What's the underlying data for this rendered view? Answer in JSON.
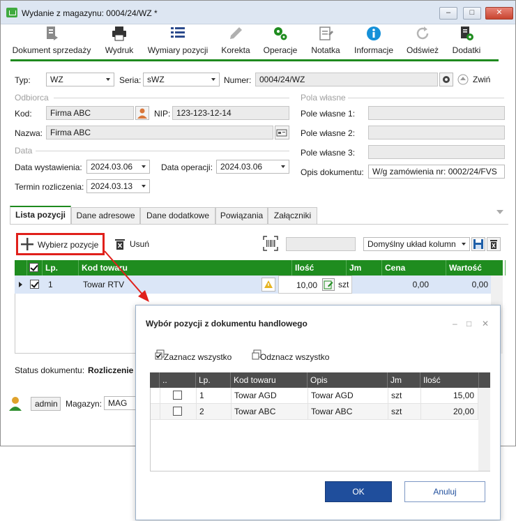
{
  "window": {
    "title": "Wydanie z magazynu: 0004/24/WZ *",
    "minimize": "–",
    "maximize": "□",
    "close": "✕"
  },
  "toolbar": {
    "doc_sales": "Dokument sprzedaży",
    "print": "Wydruk",
    "dimensions": "Wymiary pozycji",
    "correction": "Korekta",
    "operations": "Operacje",
    "note": "Notatka",
    "info": "Informacje",
    "refresh": "Odśwież",
    "addons": "Dodatki"
  },
  "header": {
    "type_label": "Typ:",
    "type_value": "WZ",
    "series_label": "Seria:",
    "series_value": "sWZ",
    "number_label": "Numer:",
    "number_value": "0004/24/WZ",
    "collapse": "Zwiń"
  },
  "recipient": {
    "group": "Odbiorca",
    "code_label": "Kod:",
    "code_value": "Firma ABC",
    "nip_label": "NIP:",
    "nip_value": "123-123-12-14",
    "name_label": "Nazwa:",
    "name_value": "Firma ABC"
  },
  "dates": {
    "group": "Data",
    "issue_label": "Data wystawienia:",
    "issue_value": "2024.03.06",
    "operation_label": "Data operacji:",
    "operation_value": "2024.03.06",
    "due_label": "Termin rozliczenia:",
    "due_value": "2024.03.13"
  },
  "custom_fields": {
    "group": "Pola własne",
    "f1": "Pole własne 1:",
    "f2": "Pole własne 2:",
    "f3": "Pole własne 3:",
    "desc_label": "Opis dokumentu:",
    "desc_value": "W/g zamówienia nr: 0002/24/FVS"
  },
  "tabs": [
    "Lista pozycji",
    "Dane adresowe",
    "Dane dodatkowe",
    "Powiązania",
    "Załączniki"
  ],
  "positions": {
    "select_btn": "Wybierz pozycje",
    "delete_btn": "Usuń",
    "layout": "Domyślny układ kolumn",
    "columns": [
      "Lp.",
      "Kod towaru",
      "Ilość",
      "Jm",
      "Cena",
      "Wartość"
    ],
    "rows": [
      {
        "lp": "1",
        "code": "Towar RTV",
        "qty": "10,00",
        "unit": "szt",
        "price": "0,00",
        "value": "0,00"
      }
    ]
  },
  "status": {
    "label": "Status dokumentu:",
    "value": "Rozliczenie p"
  },
  "footer": {
    "user": "admin",
    "warehouse_label": "Magazyn:",
    "warehouse_value": "MAG"
  },
  "dialog": {
    "title": "Wybór pozycji z dokumentu handlowego",
    "minimize": "–",
    "maximize": "□",
    "close": "✕",
    "select_all": "Zaznacz wszystko",
    "deselect_all": "Odznacz wszystko",
    "columns": [
      "..",
      "Lp.",
      "Kod towaru",
      "Opis",
      "Jm",
      "Ilość"
    ],
    "rows": [
      {
        "lp": "1",
        "code": "Towar AGD",
        "desc": "Towar AGD",
        "unit": "szt",
        "qty": "15,00"
      },
      {
        "lp": "2",
        "code": "Towar ABC",
        "desc": "Towar ABC",
        "unit": "szt",
        "qty": "20,00"
      }
    ],
    "ok": "OK",
    "cancel": "Anuluj"
  },
  "colors": {
    "accent_green": "#1f8c1f",
    "highlight_red": "#e0201b",
    "primary_blue": "#1f4e9c"
  }
}
